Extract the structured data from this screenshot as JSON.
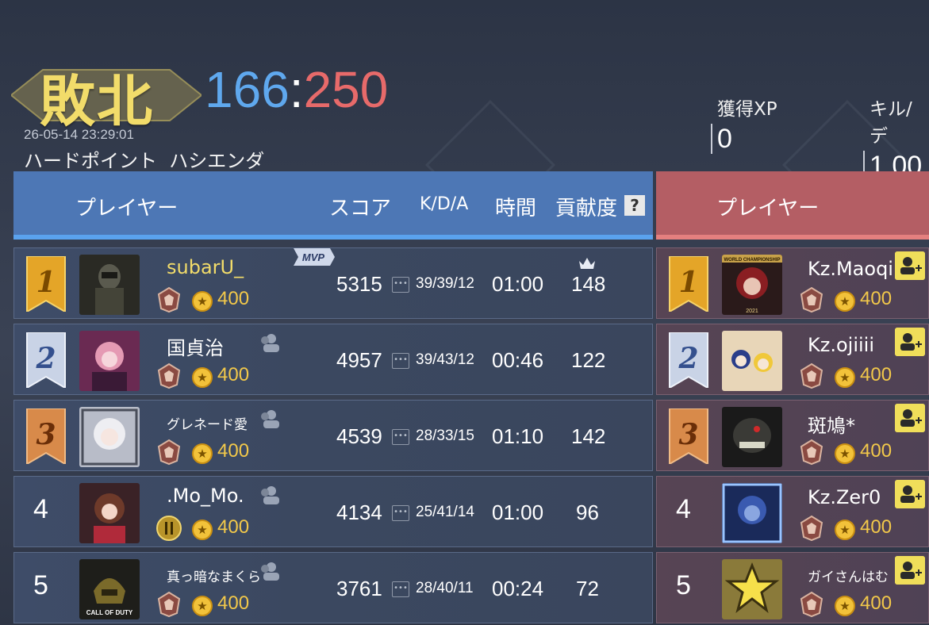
{
  "header": {
    "result": "敗北",
    "score_blue": "166",
    "score_sep": ":",
    "score_red": "250",
    "timestamp": "26-05-14 23:29:01",
    "mode_map": "ハードポイント  ハシエンダ",
    "stats": [
      {
        "label": "獲得XP",
        "value": "0"
      },
      {
        "label": "キル/デ",
        "value": "1.00"
      }
    ]
  },
  "blue_team": {
    "columns": {
      "player": "プレイヤー",
      "score": "スコア",
      "kda": "K/D/A",
      "time": "時間",
      "contribution": "貢献度",
      "help": "?"
    },
    "rows": [
      {
        "rank": "1",
        "name": "subarU_",
        "coins": "400",
        "score": "5315",
        "kda": "39/39/12",
        "time": "01:00",
        "contribution": "148",
        "mvp": "MVP",
        "avatar_icon": "soldier-avatar-icon"
      },
      {
        "rank": "2",
        "name": "国貞治",
        "coins": "400",
        "score": "4957",
        "kda": "39/43/12",
        "time": "00:46",
        "contribution": "122",
        "avatar_icon": "anime-girl-avatar-icon"
      },
      {
        "rank": "3",
        "name": "グレネード愛",
        "coins": "400",
        "score": "4539",
        "kda": "28/33/15",
        "time": "01:10",
        "contribution": "142",
        "avatar_icon": "white-hair-girl-avatar-icon"
      },
      {
        "rank": "4",
        "name": ".Mo_Mo.",
        "coins": "400",
        "score": "4134",
        "kda": "25/41/14",
        "time": "01:00",
        "contribution": "96",
        "avatar_icon": "brown-hair-girl-avatar-icon"
      },
      {
        "rank": "5",
        "name": "真っ暗なまくら",
        "coins": "400",
        "score": "3761",
        "kda": "28/40/11",
        "time": "00:24",
        "contribution": "72",
        "avatar_icon": "samurai-helmet-avatar-icon",
        "avatar_text": "CALL OF DUTY"
      }
    ]
  },
  "red_team": {
    "columns": {
      "player": "プレイヤー"
    },
    "rows": [
      {
        "rank": "1",
        "name": "Kz.Maoqi",
        "coins": "400",
        "avatar_icon": "red-hair-woman-avatar-icon",
        "avatar_text": "WORLD CHAMPIONSHIP",
        "avatar_year": "2021"
      },
      {
        "rank": "2",
        "name": "Kz.ojiiii",
        "coins": "400",
        "avatar_icon": "cartoon-girls-avatar-icon"
      },
      {
        "rank": "3",
        "name": "斑鳩*",
        "coins": "400",
        "avatar_icon": "monster-avatar-icon"
      },
      {
        "rank": "4",
        "name": "Kz.Zer0",
        "coins": "400",
        "avatar_icon": "blue-soldier-avatar-icon"
      },
      {
        "rank": "5",
        "name": "ガイさんはむ",
        "coins": "400",
        "avatar_icon": "sheriff-star-avatar-icon"
      }
    ]
  },
  "colors": {
    "gold": "#f2dc6a",
    "blue_team": "#4d77b5",
    "red_team": "#b45e64",
    "blue_score": "#5fa8ee",
    "red_score": "#e76a6a"
  }
}
